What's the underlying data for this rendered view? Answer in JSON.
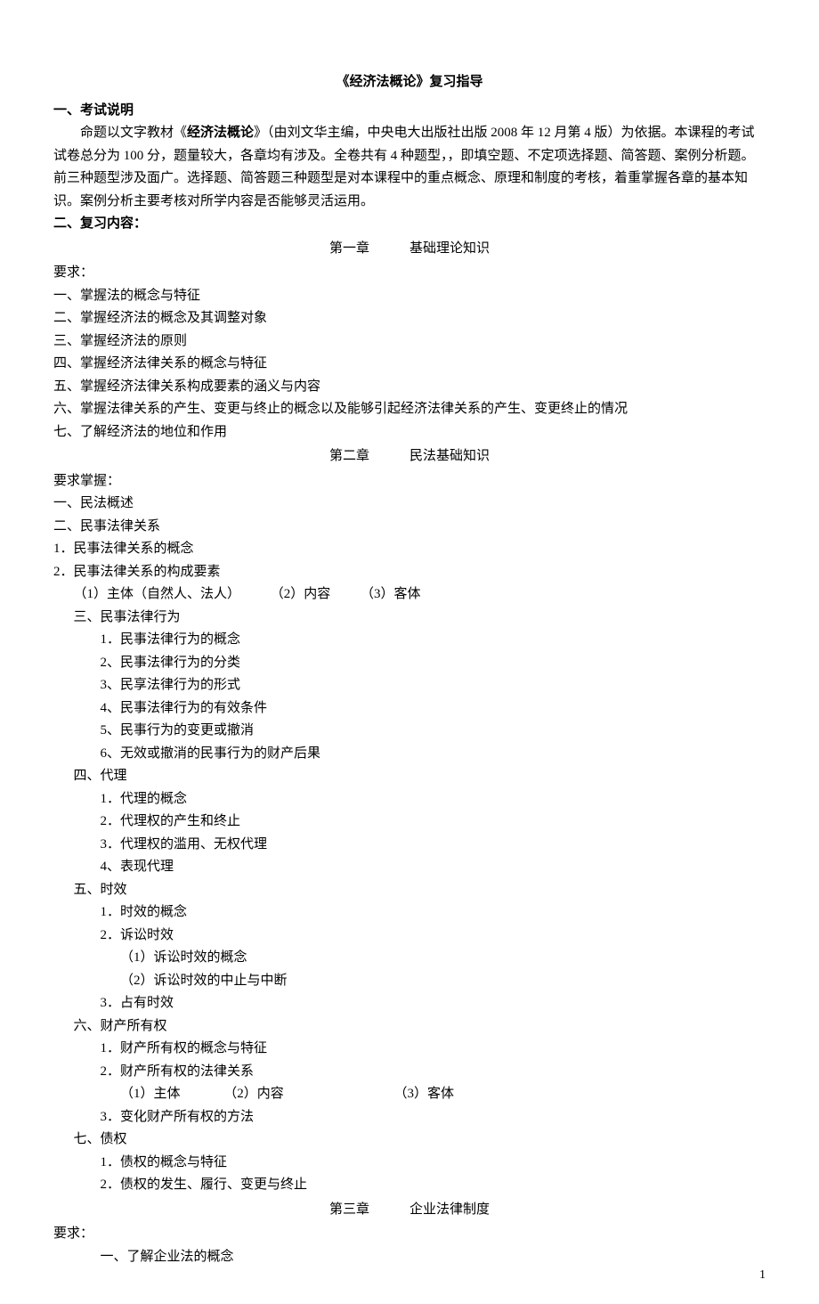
{
  "title": "《经济法概论》复习指导",
  "s1": {
    "heading": "一、考试说明",
    "para_pre": "命题以文字教材《",
    "para_bold": "经济法概论",
    "para_post": "》（由刘文华主编，中央电大出版社出版 2008 年 12 月第 4 版）为依据。本课程的考试试卷总分为 100 分，题量较大，各章均有涉及。全卷共有 4 种题型，，即填空题、不定项选择题、简答题、案例分析题。前三种题型涉及面广。选择题、简答题三种题型是对本课程中的重点概念、原理和制度的考核，着重掌握各章的基本知识。案例分析主要考核对所学内容是否能够灵活运用。"
  },
  "s2": {
    "heading": "二、复习内容：",
    "ch1": {
      "num": "第一章",
      "title": "基础理论知识",
      "req": "要求：",
      "items": [
        "一、掌握法的概念与特征",
        "二、掌握经济法的概念及其调整对象",
        "三、掌握经济法的原则",
        "四、掌握经济法律关系的概念与特征",
        "五、掌握经济法律关系构成要素的涵义与内容",
        "六、掌握法律关系的产生、变更与终止的概念以及能够引起经济法律关系的产生、变更终止的情况",
        "七、了解经济法的地位和作用"
      ]
    },
    "ch2": {
      "num": "第二章",
      "title": "民法基础知识",
      "req": "要求掌握：",
      "p1": "一、民法概述",
      "p2": "二、民事法律关系",
      "p2_1": "1．民事法律关系的概念",
      "p2_2": "2．民事法律关系的构成要素",
      "p2_2_a": "（1）主体（自然人、法人）",
      "p2_2_b": "（2）内容",
      "p2_2_c": "（3）客体",
      "p3": "三、民事法律行为",
      "p3_1": "1．民事法律行为的概念",
      "p3_2": "2、民事法律行为的分类",
      "p3_3": "3、民享法律行为的形式",
      "p3_4": "4、民事法律行为的有效条件",
      "p3_5": "5、民事行为的变更或撤消",
      "p3_6": "6、无效或撤消的民事行为的财产后果",
      "p4": "四、代理",
      "p4_1": "1．代理的概念",
      "p4_2": "2．代理权的产生和终止",
      "p4_3": "3．代理权的滥用、无权代理",
      "p4_4": "4、表现代理",
      "p5": "五、时效",
      "p5_1": "1．时效的概念",
      "p5_2": "2．诉讼时效",
      "p5_2_1": "（1）诉讼时效的概念",
      "p5_2_2": "（2）诉讼时效的中止与中断",
      "p5_3": "3．占有时效",
      "p6": "六、财产所有权",
      "p6_1": "1．财产所有权的概念与特征",
      "p6_2": "2．财产所有权的法律关系",
      "p6_2_a": "（1）主体",
      "p6_2_b": "（2）内容",
      "p6_2_c": "（3）客体",
      "p6_3": "3．变化财产所有权的方法",
      "p7": "七、债权",
      "p7_1": "1．债权的概念与特征",
      "p7_2": "2．债权的发生、履行、变更与终止"
    },
    "ch3": {
      "num": "第三章",
      "title": "企业法律制度",
      "req": "要求：",
      "p1": "一、了解企业法的概念"
    }
  },
  "page_number": "1"
}
